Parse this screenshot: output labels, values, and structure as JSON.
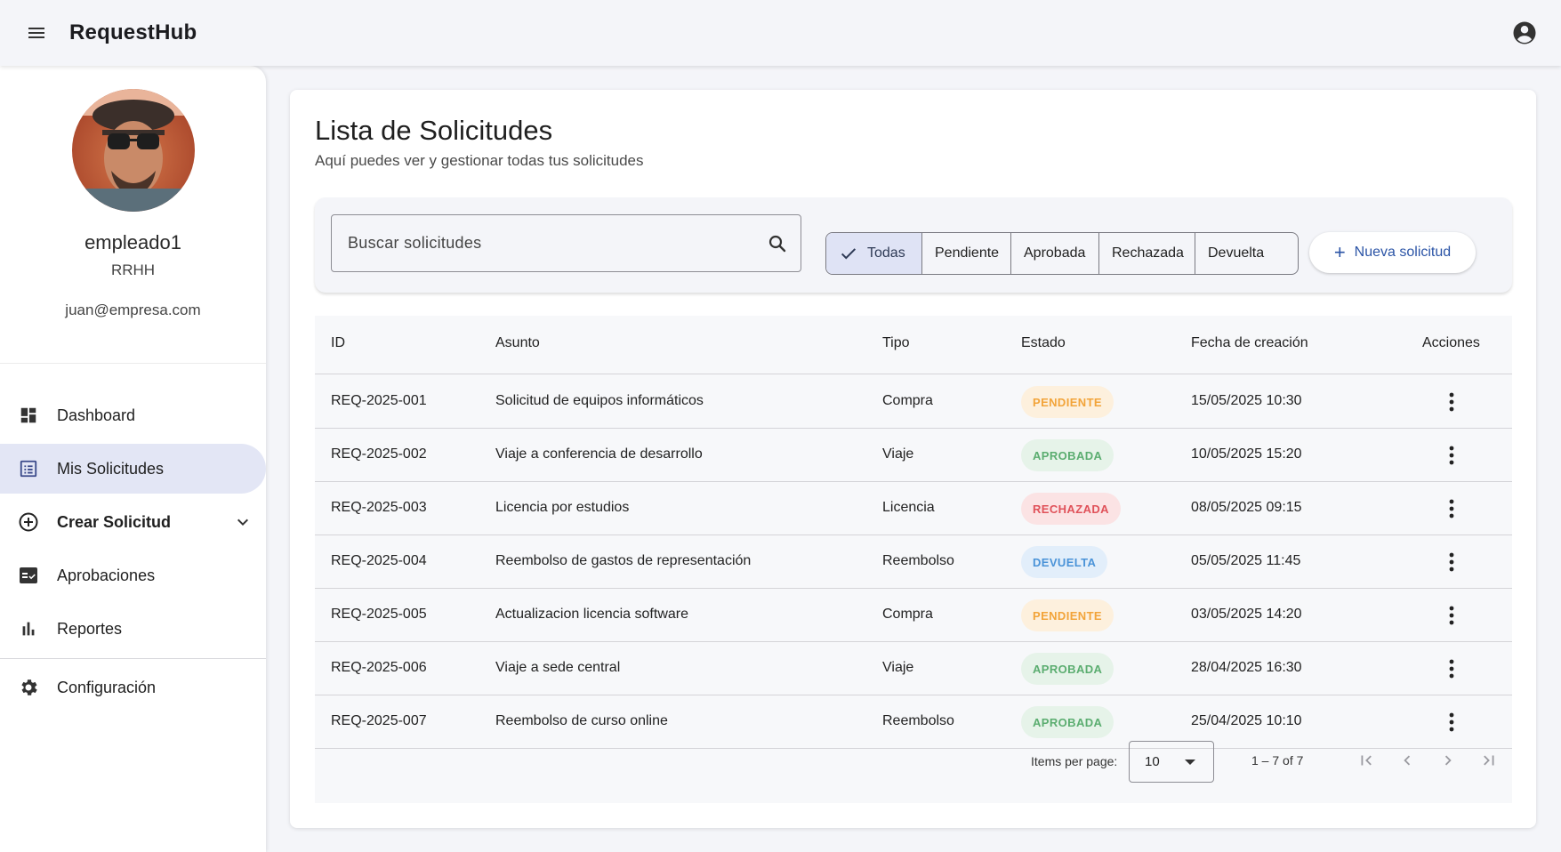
{
  "app": {
    "title": "RequestHub"
  },
  "user": {
    "name": "empleado1",
    "department": "RRHH",
    "email": "juan@empresa.com"
  },
  "nav": {
    "items": [
      {
        "label": "Dashboard",
        "icon": "dashboard-icon"
      },
      {
        "label": "Mis Solicitudes",
        "icon": "list-icon",
        "active": true
      },
      {
        "label": "Crear Solicitud",
        "icon": "add-circle-icon",
        "expandable": true
      },
      {
        "label": "Aprobaciones",
        "icon": "approval-icon"
      },
      {
        "label": "Reportes",
        "icon": "bar-chart-icon"
      },
      {
        "label": "Configuración",
        "icon": "gear-icon"
      }
    ]
  },
  "page": {
    "title": "Lista de Solicitudes",
    "subtitle": "Aquí puedes ver y gestionar todas tus solicitudes"
  },
  "search": {
    "placeholder": "Buscar solicitudes",
    "value": ""
  },
  "filters": {
    "options": [
      "Todas",
      "Pendiente",
      "Aprobada",
      "Rechazada",
      "Devuelta"
    ],
    "selected": "Todas"
  },
  "new_button": {
    "label": "Nueva solicitud"
  },
  "table": {
    "columns": [
      "ID",
      "Asunto",
      "Tipo",
      "Estado",
      "Fecha de creación",
      "Acciones"
    ],
    "rows": [
      {
        "id": "REQ-2025-001",
        "subject": "Solicitud de equipos informáticos",
        "type": "Compra",
        "status": "PENDIENTE",
        "date": "15/05/2025 10:30"
      },
      {
        "id": "REQ-2025-002",
        "subject": "Viaje a conferencia de desarrollo",
        "type": "Viaje",
        "status": "APROBADA",
        "date": "10/05/2025 15:20"
      },
      {
        "id": "REQ-2025-003",
        "subject": "Licencia por estudios",
        "type": "Licencia",
        "status": "RECHAZADA",
        "date": "08/05/2025 09:15"
      },
      {
        "id": "REQ-2025-004",
        "subject": "Reembolso de gastos de representación",
        "type": "Reembolso",
        "status": "DEVUELTA",
        "date": "05/05/2025 11:45"
      },
      {
        "id": "REQ-2025-005",
        "subject": "Actualizacion licencia software",
        "type": "Compra",
        "status": "PENDIENTE",
        "date": "03/05/2025 14:20"
      },
      {
        "id": "REQ-2025-006",
        "subject": "Viaje a sede central",
        "type": "Viaje",
        "status": "APROBADA",
        "date": "28/04/2025 16:30"
      },
      {
        "id": "REQ-2025-007",
        "subject": "Reembolso de curso online",
        "type": "Reembolso",
        "status": "APROBADA",
        "date": "25/04/2025 10:10"
      }
    ]
  },
  "status_colors": {
    "PENDIENTE": {
      "bg": "#fdf0dd",
      "fg": "#f2a43a"
    },
    "APROBADA": {
      "bg": "#e6f3e9",
      "fg": "#5bad70"
    },
    "RECHAZADA": {
      "bg": "#fbe3e4",
      "fg": "#e0525a"
    },
    "DEVUELTA": {
      "bg": "#e2eefa",
      "fg": "#4a93d8"
    }
  },
  "pagination": {
    "items_per_page_label": "Items per page:",
    "items_per_page": "10",
    "range": "1 – 7 of 7"
  },
  "colors": {
    "accent": "#2b54a6",
    "nav_active_bg": "#e3e6f5",
    "filter_selected_bg": "#dfe3f5"
  }
}
